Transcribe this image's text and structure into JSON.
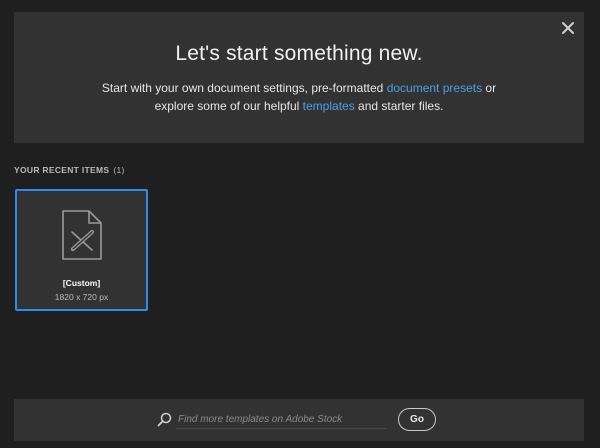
{
  "hero": {
    "title": "Let's start something new.",
    "desc_line1_prefix": "Start with your own document settings, pre-formatted ",
    "desc_link_presets": "document presets",
    "desc_line1_suffix": " or",
    "desc_line2_prefix": "explore some of our helpful ",
    "desc_link_templates": "templates",
    "desc_line2_suffix": " and starter files.",
    "close_icon": "close-icon"
  },
  "recent": {
    "header": "YOUR RECENT ITEMS",
    "count": "(1)",
    "items": [
      {
        "name": "[Custom]",
        "size": "1820 x 720 px",
        "icon": "document-illustrator-icon"
      }
    ]
  },
  "search": {
    "placeholder": "Find more templates on Adobe Stock",
    "value": "",
    "icon": "search-icon",
    "go_label": "Go"
  },
  "colors": {
    "background": "#1f1f1f",
    "panel": "#323232",
    "accent": "#2d8ceb",
    "link": "#4b9fe9"
  }
}
